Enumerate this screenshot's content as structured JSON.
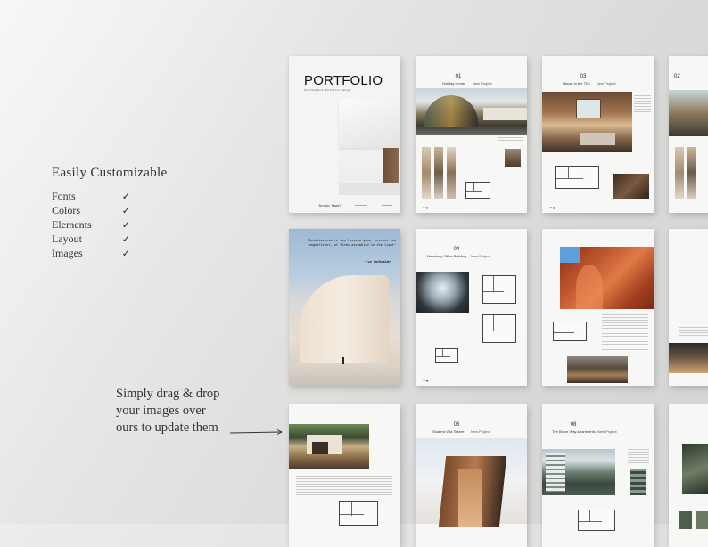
{
  "sidebar": {
    "heading": "Easily Customizable",
    "features": [
      {
        "label": "Fonts",
        "checked": true
      },
      {
        "label": "Colors",
        "checked": true
      },
      {
        "label": "Elements",
        "checked": true
      },
      {
        "label": "Layout",
        "checked": true
      },
      {
        "label": "Images",
        "checked": true
      }
    ]
  },
  "callout": {
    "lines": [
      "Simply drag & drop",
      "your images over",
      "ours to update them"
    ]
  },
  "cover": {
    "title": "PORTFOLIO",
    "subtitle": "Architecture Portfolio Design",
    "author": "Jordan Powell"
  },
  "quote": {
    "text": "\"Architecture is the learned game, correct and magnificent, of forms assembled in the light\"",
    "author": "- Le Corbusier"
  },
  "projects": [
    {
      "number": "01",
      "title": "Holiday Home",
      "tag": "New Project"
    },
    {
      "number": "03",
      "title": "House in the 70's",
      "tag": "New Project"
    },
    {
      "number": "04",
      "title": "Meadway Office Building",
      "tag": "New Project"
    },
    {
      "number": "06",
      "title": "Student Villa Tekere",
      "tag": "New Project"
    },
    {
      "number": "08",
      "title": "The Brave Way Apartments",
      "tag": "New Project"
    }
  ],
  "colors": {
    "background": "#e6e6e5",
    "page": "#f7f7f6",
    "text": "#333333",
    "accent_terracotta": "#b2502e",
    "sky": "#9db9d3"
  }
}
